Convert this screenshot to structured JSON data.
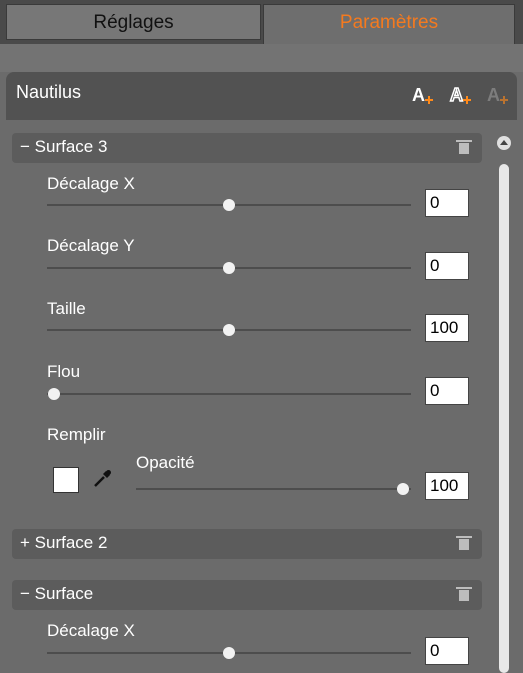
{
  "tabs": {
    "left": "Réglages",
    "right": "Paramètres",
    "active_color": "#f47a1f"
  },
  "panel": {
    "title": "Nautilus",
    "icons": [
      "add-text-icon",
      "add-shape-icon",
      "add-effect-icon"
    ]
  },
  "sections": [
    {
      "label": "− Surface 3",
      "expanded": true,
      "params": [
        {
          "label": "Décalage X",
          "value": "0",
          "level": 0.5
        },
        {
          "label": "Décalage Y",
          "value": "0",
          "level": 0.5
        },
        {
          "label": "Taille",
          "value": "100",
          "level": 0.5
        },
        {
          "label": "Flou",
          "value": "0",
          "level": 0.0
        }
      ],
      "fill": {
        "label": "Remplir",
        "opacity_label": "Opacité",
        "opacity_value": "100",
        "opacity_level": 1.0,
        "color": "#ffffff"
      }
    },
    {
      "label": "+ Surface 2",
      "expanded": false
    },
    {
      "label": "− Surface",
      "expanded": true,
      "params": [
        {
          "label": "Décalage X",
          "value": "0",
          "level": 0.5
        }
      ]
    }
  ]
}
